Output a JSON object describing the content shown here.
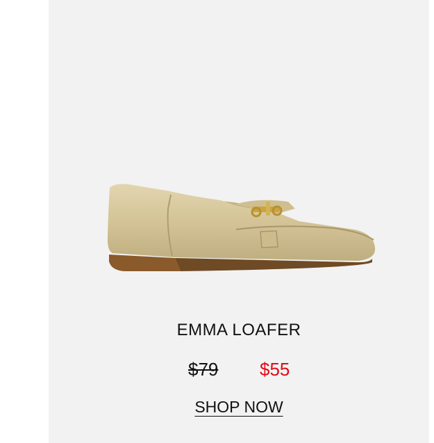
{
  "product": {
    "name": "EMMA LOAFER",
    "original_price": "$79",
    "sale_price": "$55",
    "cta_label": "SHOP NOW",
    "image_icon": "gold-loafer-image"
  },
  "colors": {
    "card_background": "#f2f2f2",
    "sale_price": "#e30b17",
    "text": "#111111",
    "shoe_leather": "#d4c49a",
    "sole": "#8b5a2b"
  }
}
